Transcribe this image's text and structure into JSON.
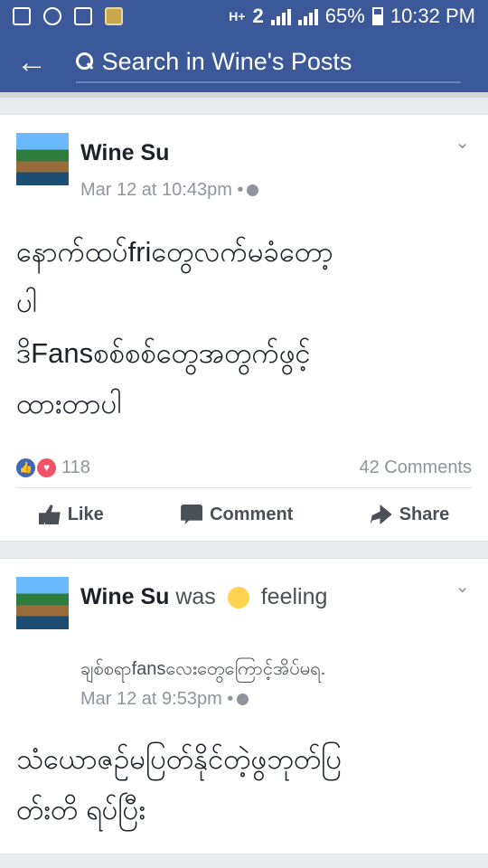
{
  "statusbar": {
    "battery": "65%",
    "time": "10:32 PM",
    "network": "H+"
  },
  "topbar": {
    "search_placeholder": "Search in Wine's Posts"
  },
  "post1": {
    "author": "Wine Su",
    "timestamp": "Mar 12 at 10:43pm •",
    "text": "နောက်ထပ်friတွေလက်မခံတော့\nပါ\nဒိFansစစ်စစ်တွေအတွက်ဖွင့်\nထားတာပါ",
    "reaction_count": "118",
    "comment_count": "42 Comments",
    "actions": {
      "like": "Like",
      "comment": "Comment",
      "share": "Share"
    }
  },
  "post2": {
    "author": "Wine Su",
    "was": "was",
    "feeling": "feeling",
    "feeling_detail": "ချစ်စရာfansလေးတွေကြောင့်အိပ်မရ.",
    "timestamp": "Mar 12 at 9:53pm •",
    "text": "သံယောဇဉ်မပြတ်နိုင်တဲ့ဖွဘုတ်ပြ\nတ်းတိ ရပ်ပြီး"
  }
}
